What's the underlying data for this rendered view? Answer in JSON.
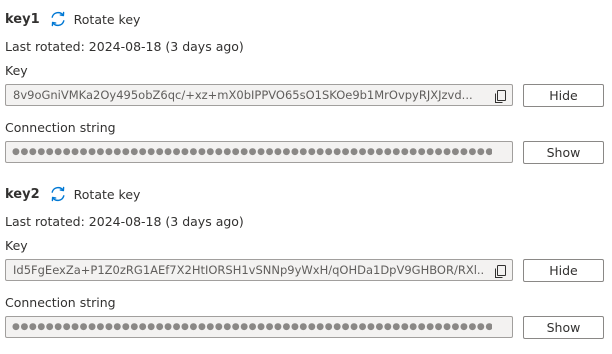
{
  "keys": [
    {
      "name": "key1",
      "rotate_label": "Rotate key",
      "last_rotated": "Last rotated: 2024-08-18 (3 days ago)",
      "key_label": "Key",
      "key_value": "8v9oGniVMKa2Oy495obZ6qc/+xz+mX0bIPPVO65sO1SKOe9b1MrOvpyRJXJzvd...",
      "key_button": "Hide",
      "conn_label": "Connection string",
      "conn_masked": "●●●●●●●●●●●●●●●●●●●●●●●●●●●●●●●●●●●●●●●●●●●●●●●●●●●●●●●●●●●● ...",
      "conn_button": "Show"
    },
    {
      "name": "key2",
      "rotate_label": "Rotate key",
      "last_rotated": "Last rotated: 2024-08-18 (3 days ago)",
      "key_label": "Key",
      "key_value": "Id5FgEexZa+P1Z0zRG1AEf7X2HtIORSH1vSNNp9yWxH/qOHDa1DpV9GHBOR/RXl...",
      "key_button": "Hide",
      "conn_label": "Connection string",
      "conn_masked": "●●●●●●●●●●●●●●●●●●●●●●●●●●●●●●●●●●●●●●●●●●●●●●●●●●●●●●●●●●●● ...",
      "conn_button": "Show"
    }
  ],
  "icons": {
    "rotate": "rotate-icon",
    "copy": "copy-icon"
  },
  "colors": {
    "accent": "#0078d4",
    "field_background": "#f3f2f1",
    "field_border": "#a19f9d",
    "text": "#323130"
  }
}
